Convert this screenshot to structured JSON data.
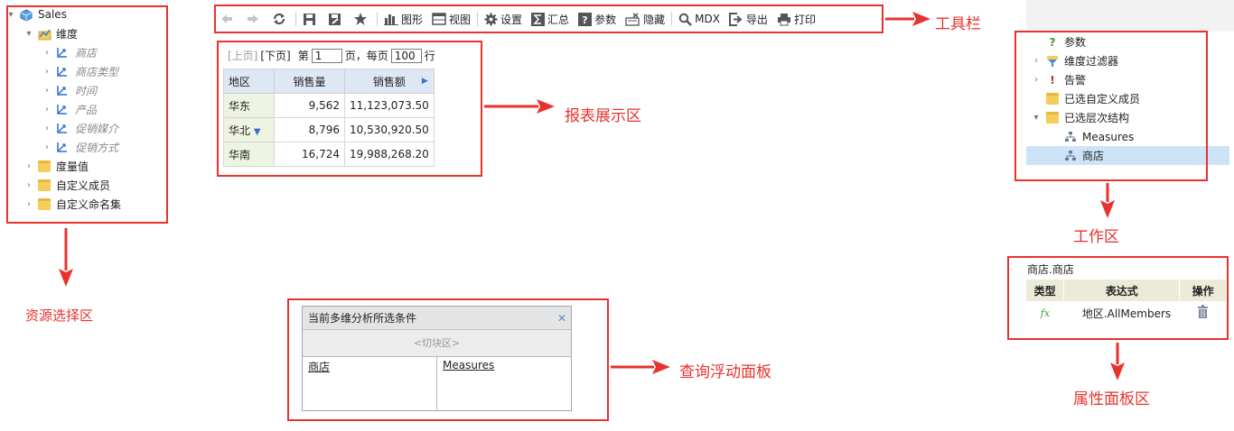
{
  "resource_tree": {
    "root": "Sales",
    "dimension_group": "维度",
    "dimensions": [
      "商店",
      "商店类型",
      "时间",
      "产品",
      "促销媒介",
      "促销方式"
    ],
    "folders": [
      "度量值",
      "自定义成员",
      "自定义命名集"
    ]
  },
  "toolbar": {
    "back_icon": "back-arrow-icon",
    "forward_icon": "forward-arrow-icon",
    "refresh_icon": "refresh-icon",
    "chart": "图形",
    "view": "视图",
    "settings": "设置",
    "summary": "汇总",
    "params": "参数",
    "hide": "隐藏",
    "mdx": "MDX",
    "export": "导出",
    "print": "打印"
  },
  "pager": {
    "prev": "[上页]",
    "next": "[下页]",
    "page_prefix": "第",
    "page_value": "1",
    "page_suffix": "页，每页",
    "per_page_value": "100",
    "rows_suffix": "行"
  },
  "report": {
    "headers": [
      "地区",
      "销售量",
      "销售额"
    ],
    "rows": [
      {
        "region": "华东",
        "qty": "9,562",
        "amount": "11,123,073.50"
      },
      {
        "region": "华北",
        "qty": "8,796",
        "amount": "10,530,920.50"
      },
      {
        "region": "华南",
        "qty": "16,724",
        "amount": "19,988,268.20"
      }
    ]
  },
  "float_panel": {
    "title": "当前多维分析所选条件",
    "slice_area": "<切块区>",
    "row_field": "商店",
    "col_field": "Measures"
  },
  "workspace": {
    "items": [
      "参数",
      "维度过滤器",
      "告警",
      "已选自定义成员",
      "已选层次结构"
    ],
    "hierarchy_children": [
      "Measures",
      "商店"
    ]
  },
  "property_panel": {
    "title": "商店.商店",
    "headers": [
      "类型",
      "表达式",
      "操作"
    ],
    "row_expression": "地区.AllMembers"
  },
  "annotations": {
    "toolbar": "工具栏",
    "report_area": "报表展示区",
    "resource_area": "资源选择区",
    "float_panel": "查询浮动面板",
    "workspace": "工作区",
    "property_panel": "属性面板区"
  },
  "colors": {
    "annotation_red": "#e8322e",
    "header_blue": "#dde8f4",
    "selected_row": "#cde3f7"
  }
}
